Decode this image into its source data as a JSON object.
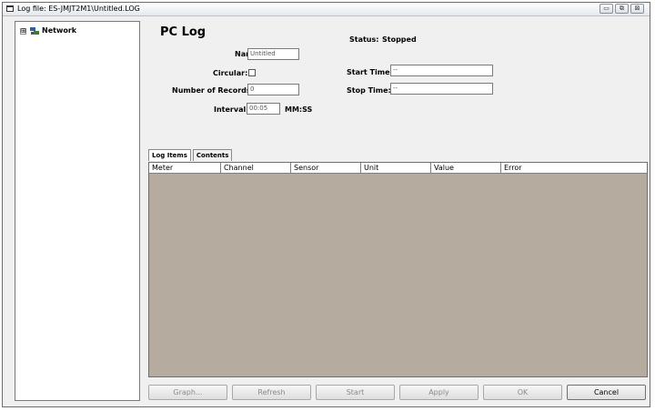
{
  "window": {
    "title": "Log file: ES-JMJT2M1\\Untitled.LOG",
    "controls": [
      "minimize-icon",
      "maximize-icon",
      "close-icon"
    ]
  },
  "tree": {
    "expander": "⊞",
    "items": [
      {
        "label": "Network",
        "icon": "network-icon"
      }
    ]
  },
  "form": {
    "heading": "PC Log",
    "name_label": "Name:",
    "name_value": "Untitled",
    "circular_label": "Circular:",
    "circular_checked": false,
    "records_label": "Number of Records:",
    "records_value": "0",
    "interval_label": "Interval:",
    "interval_value": "00:05",
    "interval_unit": "MM:SS",
    "status_label": "Status:",
    "status_value": "Stopped",
    "start_time_label": "Start Time:",
    "start_time_value": "--",
    "stop_time_label": "Stop Time:",
    "stop_time_value": "--"
  },
  "tabs": [
    {
      "label": "Log Items",
      "active": true
    },
    {
      "label": "Contents",
      "active": false
    }
  ],
  "table": {
    "columns": [
      "Meter",
      "Channel",
      "Sensor",
      "Unit",
      "Value",
      "Error"
    ],
    "rows": [],
    "background": "#b5ab9e"
  },
  "buttons": {
    "graph": "Graph...",
    "refresh": "Refresh",
    "start": "Start",
    "apply": "Apply",
    "ok": "OK",
    "cancel": "Cancel"
  }
}
